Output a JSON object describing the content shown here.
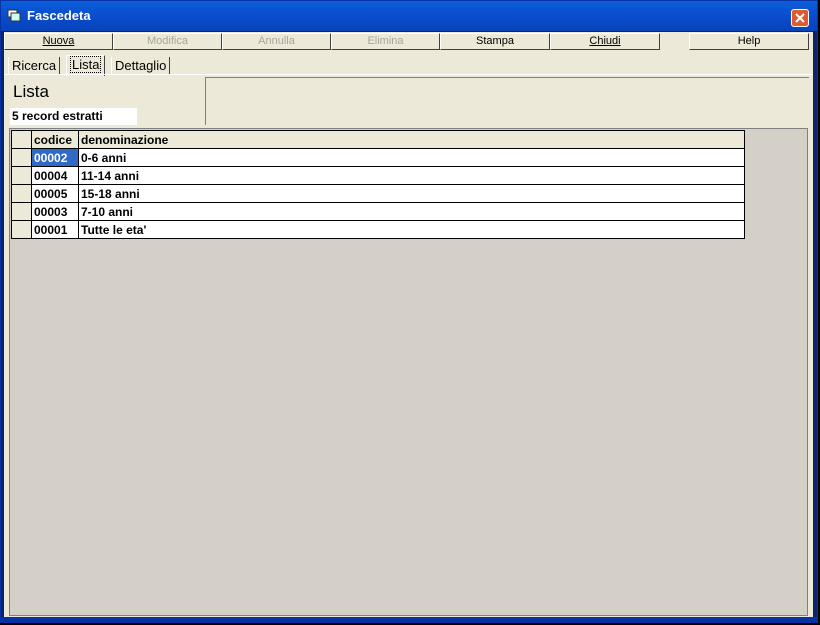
{
  "window": {
    "title": "Fascedeta"
  },
  "toolbar": {
    "nuova": "Nuova",
    "modifica": "Modifica",
    "annulla": "Annulla",
    "elimina": "Elimina",
    "stampa": "Stampa",
    "chiudi": "Chiudi",
    "help": "Help"
  },
  "tabs": [
    "Ricerca",
    "Lista",
    "Dettaglio"
  ],
  "panel": {
    "title": "Lista",
    "record_count": "5 record estratti"
  },
  "grid": {
    "columns": [
      "codice",
      "denominazione"
    ],
    "rows": [
      [
        "00002",
        "0-6 anni"
      ],
      [
        "00004",
        "11-14 anni"
      ],
      [
        "00005",
        "15-18 anni"
      ],
      [
        "00003",
        "7-10 anni"
      ],
      [
        "00001",
        "Tutte le eta'"
      ]
    ]
  }
}
